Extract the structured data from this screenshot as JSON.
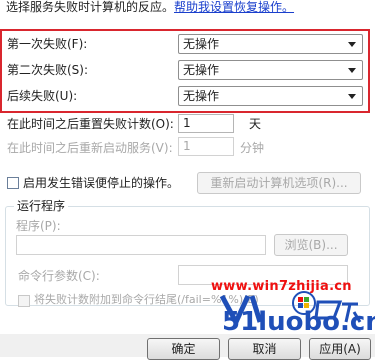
{
  "intro": {
    "text": "选择服务失败时计算机的反应。",
    "help_link": "帮助我设置恢复操作。"
  },
  "failures": [
    {
      "label": "第一次失败(F):",
      "value": "无操作"
    },
    {
      "label": "第二次失败(S):",
      "value": "无操作"
    },
    {
      "label": "后续失败(U):",
      "value": "无操作"
    }
  ],
  "reset_count": {
    "label": "在此时间之后重置失败计数(O):",
    "value": "1",
    "unit": "天"
  },
  "restart_service": {
    "label": "在此时间之后重新启动服务(V):",
    "value": "1",
    "unit": "分钟"
  },
  "enable_actions": {
    "label": "启用发生错误便停止的操作。",
    "button": "重新启动计算机选项(R)..."
  },
  "run_program": {
    "group_title": "运行程序",
    "program_label": "程序(P):",
    "browse_button": "浏览(B)...",
    "params_label": "命令行参数(C):",
    "append_label": "将失败计数附加到命令行结尾(/fail=%1%)(E)"
  },
  "watermark": {
    "site": "www.win7zhijia.cn",
    "logo_text": "51luobo.cn",
    "colors": {
      "red": "#ef1010",
      "blue": "#1f4fb8",
      "green": "#3da82c"
    }
  },
  "footer": {
    "ok": "确定",
    "cancel": "取消",
    "apply": "应用(A)"
  }
}
